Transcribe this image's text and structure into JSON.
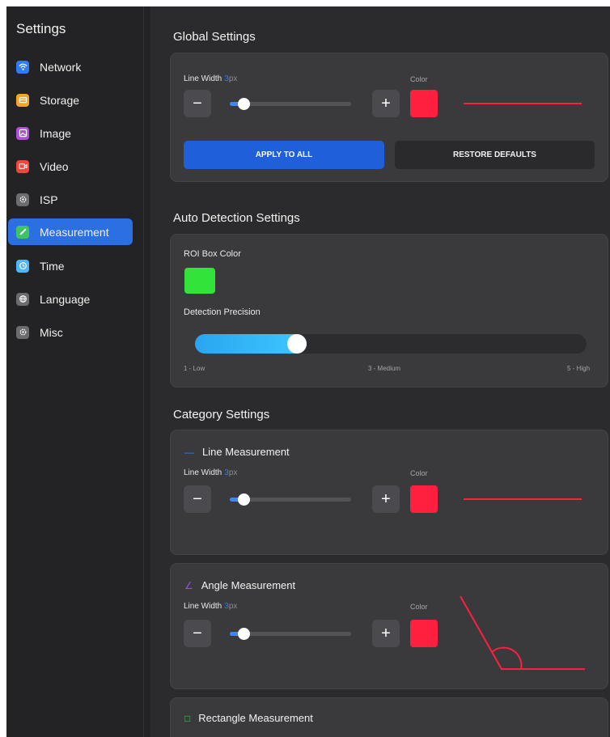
{
  "sidebar": {
    "title": "Settings",
    "items": [
      {
        "label": "Network",
        "icon": "wifi-icon",
        "color": "#2f7df6",
        "active": false
      },
      {
        "label": "Storage",
        "icon": "storage-icon",
        "color": "#f5a524",
        "active": false
      },
      {
        "label": "Image",
        "icon": "image-icon",
        "color": "#b04fd9",
        "active": false
      },
      {
        "label": "Video",
        "icon": "video-icon",
        "color": "#f0463c",
        "active": false
      },
      {
        "label": "ISP",
        "icon": "isp-gear-icon",
        "color": "#6b6b70",
        "active": false
      },
      {
        "label": "Measurement",
        "icon": "ruler-icon",
        "color": "#3ec463",
        "active": true
      },
      {
        "label": "Time",
        "icon": "clock-icon",
        "color": "#4fb6f5",
        "active": false
      },
      {
        "label": "Language",
        "icon": "globe-icon",
        "color": "#6b6b70",
        "active": false
      },
      {
        "label": "Misc",
        "icon": "misc-gear-icon",
        "color": "#6b6b70",
        "active": false
      }
    ]
  },
  "global": {
    "title": "Global Settings",
    "line_width_label": "Line Width",
    "line_width_value": "3",
    "unit": "px",
    "color_label": "Color",
    "color": "#ff1f3f",
    "slider_fraction": 0.08,
    "minus": "−",
    "plus": "+",
    "apply_label": "APPLY TO ALL",
    "restore_label": "RESTORE DEFAULTS"
  },
  "auto": {
    "title": "Auto Detection Settings",
    "roi_label": "ROI Box Color",
    "roi_color": "#32e43a",
    "precision_label": "Detection Precision",
    "precision_level": 2,
    "precision_min": 1,
    "precision_max": 5,
    "tick_low": "1 - Low",
    "tick_mid": "3 - Medium",
    "tick_high": "5 - High"
  },
  "category": {
    "title": "Category Settings",
    "line": {
      "title": "Line Measurement",
      "glyph": "—",
      "glyph_color": "#2f7df6",
      "line_width_label": "Line Width",
      "line_width_value": "3",
      "unit": "px",
      "color_label": "Color",
      "color": "#ff1f3f",
      "slider_fraction": 0.08,
      "minus": "−",
      "plus": "+"
    },
    "angle": {
      "title": "Angle Measurement",
      "glyph": "∠",
      "glyph_color": "#9a4fe0",
      "line_width_label": "Line Width",
      "line_width_value": "3",
      "unit": "px",
      "color_label": "Color",
      "color": "#ff1f3f",
      "slider_fraction": 0.08,
      "minus": "−",
      "plus": "+"
    },
    "rectangle": {
      "title": "Rectangle Measurement",
      "glyph": "□",
      "glyph_color": "#3ec463"
    }
  }
}
